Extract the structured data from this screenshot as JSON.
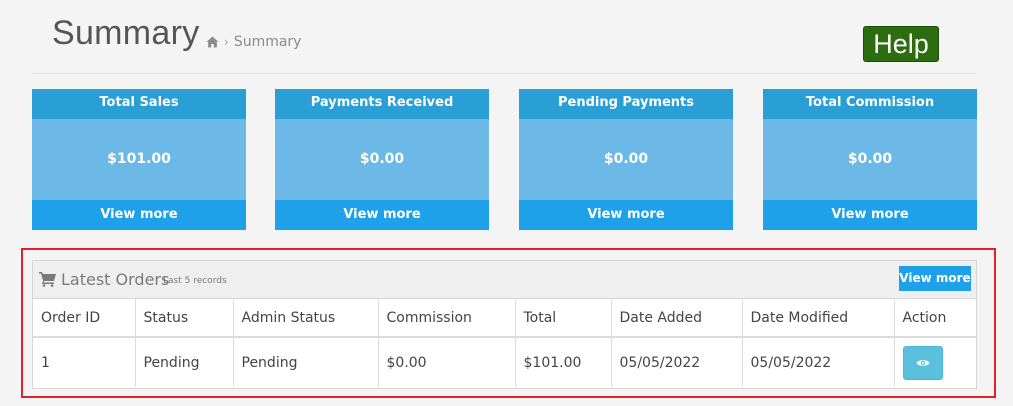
{
  "header": {
    "title": "Summary",
    "breadcrumb_label": "Summary",
    "help_label": "Help"
  },
  "cards": [
    {
      "title": "Total Sales",
      "value": "$101.00",
      "link": "View more"
    },
    {
      "title": "Payments Received",
      "value": "$0.00",
      "link": "View more"
    },
    {
      "title": "Pending Payments",
      "value": "$0.00",
      "link": "View more"
    },
    {
      "title": "Total Commission",
      "value": "$0.00",
      "link": "View more"
    }
  ],
  "orders": {
    "title": "Latest Orders",
    "subtitle": "Last 5 records",
    "view_more": "View more",
    "columns": [
      "Order ID",
      "Status",
      "Admin Status",
      "Commission",
      "Total",
      "Date Added",
      "Date Modified",
      "Action"
    ],
    "rows": [
      [
        "1",
        "Pending",
        "Pending",
        "$0.00",
        "$101.00",
        "05/05/2022",
        "05/05/2022"
      ]
    ]
  },
  "icons": {
    "home": "home-icon",
    "cart": "shopping-cart-icon",
    "action": "eye-icon"
  },
  "colors": {
    "card_header": "#2a9fd6",
    "card_body": "#6cb8e6",
    "card_footer": "#1ea1e8",
    "help_button": "#2c6e0f",
    "highlight_border": "#e3212e",
    "action_button": "#5bc0de"
  }
}
